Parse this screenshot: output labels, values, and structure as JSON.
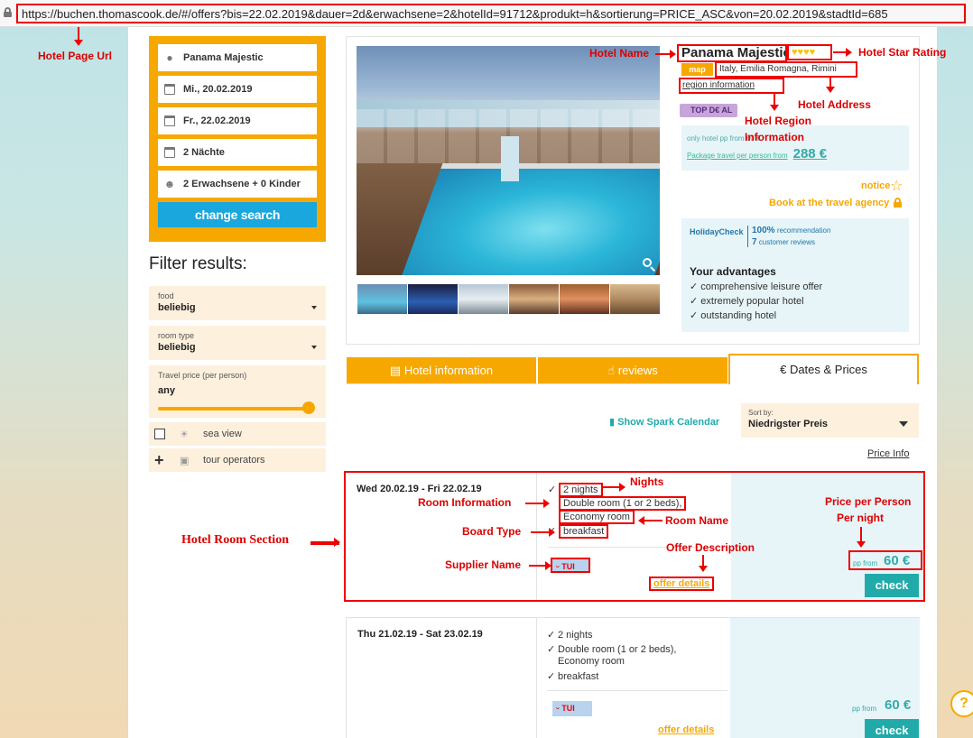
{
  "url": "https://buchen.thomascook.de/#/offers?bis=22.02.2019&dauer=2d&erwachsene=2&hotelId=91712&produkt=h&sortierung=PRICE_ASC&von=20.02.2019&stadtId=685",
  "search": {
    "destination": "Panama Majestic",
    "from_date": "Mi., 20.02.2019",
    "to_date": "Fr., 22.02.2019",
    "nights": "2 Nächte",
    "travellers": "2 Erwachsene + 0 Kinder",
    "change_label": "change search"
  },
  "filters": {
    "title": "Filter results:",
    "food_label": "food",
    "food_value": "beliebig",
    "room_label": "room type",
    "room_value": "beliebig",
    "price_label": "Travel price (per person)",
    "price_value": "any",
    "price_slider_level": 1.0,
    "sea_view": "sea view",
    "tour_operators": "tour operators"
  },
  "hotel": {
    "name": "Panama Majestic",
    "stars": "♥♥♥♥",
    "map_label": "map",
    "address": "Italy, Emilia Romagna, Rimini",
    "region_info": "region information",
    "badge": "TOP D€ AL",
    "price_line1": "only hotel pp from 60 €",
    "price_line2": "Package travel per person from",
    "package_price": "288 €",
    "notice": "notice",
    "book_agency": "Book at the travel agency",
    "holidaycheck_logo": "HolidayCheck",
    "recommend_pct": "100%",
    "recommend_label": "recommendation",
    "reviews_count": "7",
    "reviews_label": "customer reviews",
    "advantages_title": "Your advantages",
    "advantages": [
      "comprehensive leisure offer",
      "extremely popular hotel",
      "outstanding hotel"
    ]
  },
  "tabs": {
    "hotel_info": "Hotel information",
    "reviews": "reviews",
    "dates_prices": "Dates & Prices"
  },
  "sort": {
    "spark_calendar": "Show Spark Calendar",
    "sort_label": "Sort by:",
    "sort_value": "Niedrigster Preis",
    "price_info": "Price Info"
  },
  "offers": [
    {
      "date": "Wed 20.02.19 - Fri 22.02.19",
      "nights": "2 nights",
      "room": "Double room (1 or 2 beds),",
      "room_name": "Economy room",
      "board": "breakfast",
      "supplier": "TUI",
      "details": "offer details",
      "pp_from": "pp from",
      "price": "60 €",
      "check": "check"
    },
    {
      "date": "Thu 21.02.19 - Sat 23.02.19",
      "nights": "2 nights",
      "room": "Double room (1 or 2 beds),",
      "room_name": "Economy room",
      "board": "breakfast",
      "supplier": "TUI",
      "details": "offer details",
      "pp_from": "pp from",
      "price": "60 €",
      "check": "check"
    }
  ],
  "annotations": {
    "page_url": "Hotel Page Url",
    "hotel_name": "Hotel Name",
    "star_rating": "Hotel Star Rating",
    "address": "Hotel Address",
    "region_1": "Hotel Region",
    "region_2": "Information",
    "nights": "Nights",
    "room_info": "Room Information",
    "room_name": "Room Name",
    "board": "Board Type",
    "supplier": "Supplier Name",
    "offer_desc": "Offer Description",
    "price_pp_1": "Price per Person",
    "price_pp_2": "Per night",
    "room_section": "Hotel Room Section"
  }
}
